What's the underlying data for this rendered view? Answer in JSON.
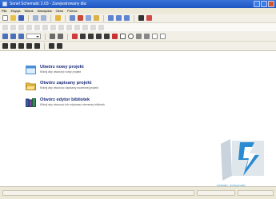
{
  "window": {
    "title": "Sonel Schematic 2.03 - Zarejestrowany dla:"
  },
  "menu": {
    "items": [
      "Plik",
      "Edycja",
      "Widok",
      "Narzędzia",
      "Okno",
      "Pomoc"
    ]
  },
  "start_page": {
    "tasks": [
      {
        "title": "Utwórz nowy projekt",
        "description": "Kliknij aby utworzyć nowy projekt",
        "icon": "new-project-icon"
      },
      {
        "title": "Otwórz zapisany projekt",
        "description": "Kliknij aby otworzyć zapisany wcześniej projekt",
        "icon": "open-folder-icon"
      },
      {
        "title": "Otwórz edytor bibliotek",
        "description": "Kliknij aby otworzyć lub edytować elementy bibliotek",
        "icon": "library-books-icon"
      }
    ]
  },
  "logo": {
    "text": "SONEL Schematic"
  },
  "colors": {
    "titlebar": "#2b63cf",
    "task_title": "#1c2c7a",
    "logo_blue": "#2a8bd0"
  }
}
